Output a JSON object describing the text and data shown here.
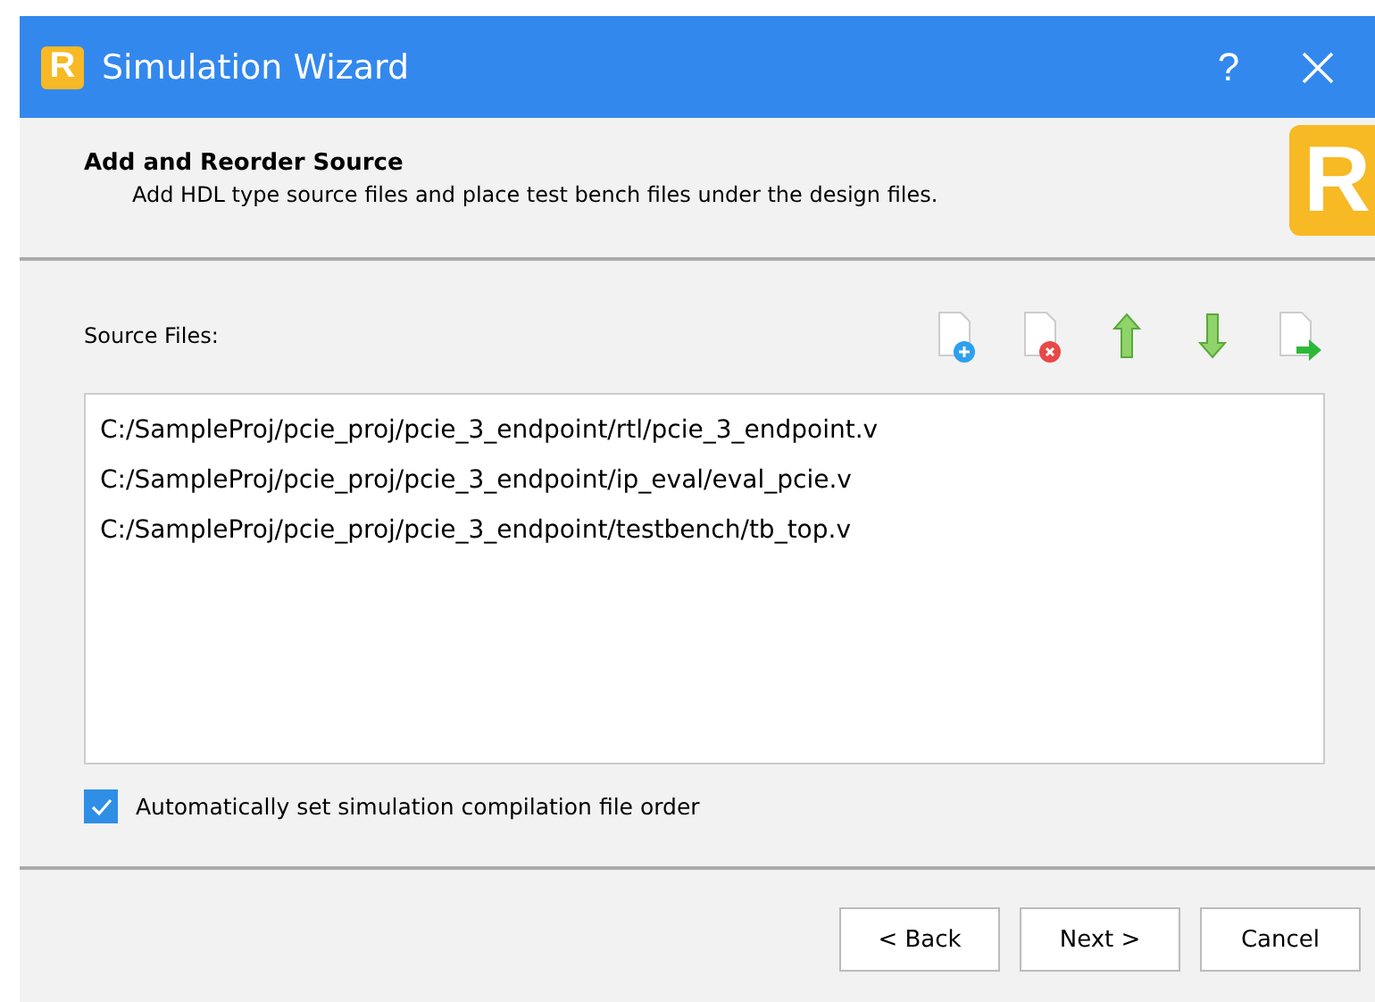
{
  "window": {
    "title": "Simulation Wizard",
    "logo_letter": "R",
    "help": "?"
  },
  "header": {
    "title": "Add and Reorder Source",
    "subtitle": "Add HDL type source files and place test bench files under the design files.",
    "logo_letter": "R"
  },
  "source_files": {
    "label": "Source Files:",
    "files": [
      {
        "path": "C:/SampleProj/pcie_proj/pcie_3_endpoint/rtl/pcie_3_endpoint.v"
      },
      {
        "path": "C:/SampleProj/pcie_proj/pcie_3_endpoint/ip_eval/eval_pcie.v"
      },
      {
        "path": "C:/SampleProj/pcie_proj/pcie_3_endpoint/testbench/tb_top.v"
      }
    ]
  },
  "toolbar": [
    {
      "kind": "add"
    },
    {
      "kind": "remove"
    },
    {
      "kind": "up"
    },
    {
      "kind": "down"
    },
    {
      "kind": "export"
    }
  ],
  "auto_order": {
    "label": "Automatically set simulation compilation file order",
    "checked": true
  },
  "buttons": [
    "< Back",
    "Next >",
    "Cancel"
  ]
}
